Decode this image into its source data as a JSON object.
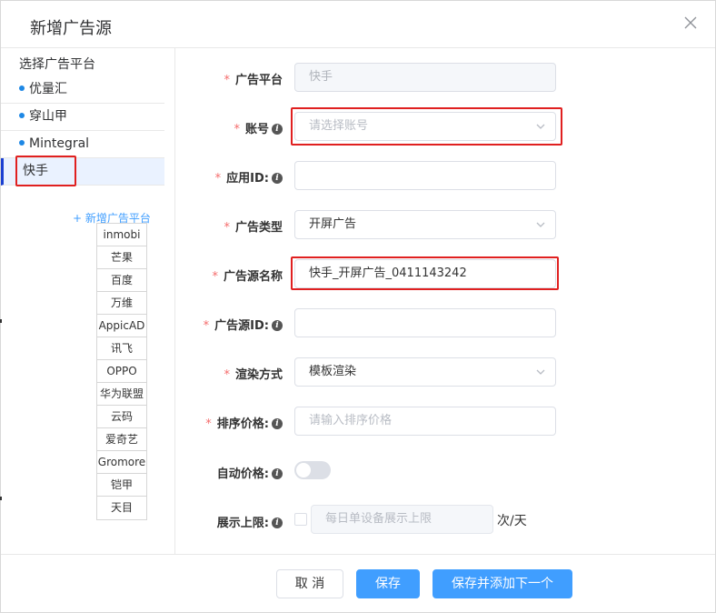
{
  "dialog": {
    "title": "新增广告源",
    "close_icon": "close-icon"
  },
  "sidebar": {
    "title": "选择广告平台",
    "platforms": [
      {
        "label": "优量汇",
        "active": false
      },
      {
        "label": "穿山甲",
        "active": false
      },
      {
        "label": "Mintegral",
        "active": false
      },
      {
        "label": "快手",
        "active": true
      }
    ],
    "add_platform_label": "+ 新增广告平台",
    "platform_options": [
      "inmobi",
      "芒果",
      "百度",
      "万维",
      "AppicAD",
      "讯飞",
      "OPPO",
      "华为联盟",
      "云码",
      "爱奇艺",
      "Gromore",
      "铠甲",
      "天目"
    ]
  },
  "form": {
    "platform": {
      "label": "广告平台",
      "value": "快手",
      "required": true
    },
    "account": {
      "label": "账号",
      "placeholder": "请选择账号",
      "required": true
    },
    "app_id": {
      "label": "应用ID:",
      "value": "",
      "required": true
    },
    "ad_type": {
      "label": "广告类型",
      "value": "开屏广告",
      "required": true
    },
    "source_name": {
      "label": "广告源名称",
      "value": "快手_开屏广告_0411143242",
      "required": true
    },
    "source_id": {
      "label": "广告源ID:",
      "value": "",
      "required": true
    },
    "render_mode": {
      "label": "渲染方式",
      "value": "模板渲染",
      "required": true
    },
    "sort_price": {
      "label": "排序价格:",
      "placeholder": "请输入排序价格",
      "required": true
    },
    "auto_price": {
      "label": "自动价格:",
      "enabled": false
    },
    "display_limit": {
      "label": "展示上限:",
      "placeholder": "每日单设备展示上限",
      "unit": "次/天",
      "checked": false
    }
  },
  "footer": {
    "cancel_label": "取 消",
    "save_label": "保存",
    "save_next_label": "保存并添加下一个"
  },
  "colors": {
    "primary": "#409eff",
    "required_star": "#f56c6c",
    "highlight_box": "#e02020",
    "active_bg": "#eaf2ff"
  }
}
